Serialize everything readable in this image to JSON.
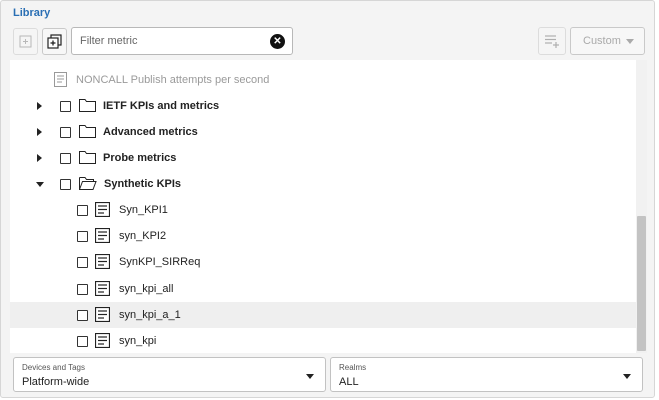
{
  "panel": {
    "title": "Library"
  },
  "toolbar": {
    "filter_placeholder": "Filter metric",
    "clear_label": "✕",
    "custom_label": "Custom"
  },
  "tree": {
    "partial_item": "NONCALL Publish attempts per second",
    "folders": [
      {
        "label": "IETF KPIs and metrics",
        "expanded": false
      },
      {
        "label": "Advanced metrics",
        "expanded": false
      },
      {
        "label": "Probe metrics",
        "expanded": false
      },
      {
        "label": "Synthetic KPIs",
        "expanded": true
      }
    ],
    "items": [
      {
        "label": "Syn_KPI1"
      },
      {
        "label": "syn_KPI2"
      },
      {
        "label": "SynKPI_SIRReq"
      },
      {
        "label": "syn_kpi_all"
      },
      {
        "label": "syn_kpi_a_1"
      },
      {
        "label": "syn_kpi"
      }
    ]
  },
  "filters": {
    "devices": {
      "label": "Devices and Tags",
      "value": "Platform-wide"
    },
    "realms": {
      "label": "Realms",
      "value": "ALL"
    }
  }
}
